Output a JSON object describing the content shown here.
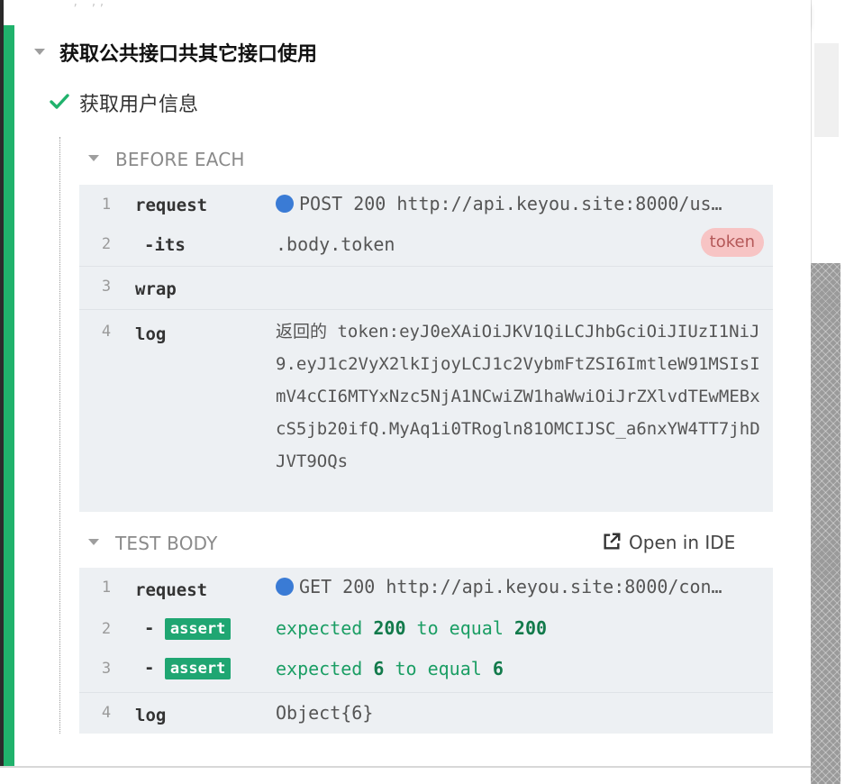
{
  "top_partial_text": "` , ` , ,",
  "suite": {
    "title": "获取公共接口共其它接口使用",
    "caret_icon": "caret-down-icon"
  },
  "test": {
    "title": "获取用户信息",
    "status_icon": "check-icon",
    "status_color": "#20b26c"
  },
  "before_each": {
    "title": "BEFORE EACH",
    "rows": [
      {
        "num": "1",
        "command": "request",
        "method": "POST",
        "status": "200",
        "url": "http://api.keyou.site:8000/us…",
        "message": "POST 200 http://api.keyou.site:8000/us…"
      },
      {
        "num": "2",
        "command": "-its",
        "message": ".body.token",
        "alias": "token"
      },
      {
        "num": "3",
        "command": "wrap",
        "message": ""
      },
      {
        "num": "4",
        "command": "log",
        "message": "返回的 token:eyJ0eXAiOiJKV1QiLCJhbGciOiJIUzI1NiJ9.eyJ1c2VyX2lkIjoyLCJ1c2VybmFtZSI6ImtleW91MSIsImV4cCI6MTYxNzc5NjA1NCwiZW1haWwiOiJrZXlvdTEwMEBxcS5jb20ifQ.MyAq1i0TRogln81OMCIJSC_a6nxYW4TT7jhDJVT9OQs"
      }
    ]
  },
  "test_body": {
    "title": "TEST BODY",
    "open_in_ide": "Open in IDE",
    "rows": [
      {
        "num": "1",
        "command": "request",
        "message": "GET 200 http://api.keyou.site:8000/con…"
      },
      {
        "num": "2",
        "command": "assert",
        "prefix": "-",
        "expected_word": "expected",
        "value1": "200",
        "to_equal": "to equal",
        "value2": "200"
      },
      {
        "num": "3",
        "command": "assert",
        "prefix": "-",
        "expected_word": "expected",
        "value1": "6",
        "to_equal": "to equal",
        "value2": "6"
      },
      {
        "num": "4",
        "command": "log",
        "message": "Object{6}"
      }
    ]
  },
  "colors": {
    "accent_green": "#20b26c",
    "request_dot": "#3a7bd5",
    "alias_bg": "#f7c4c4",
    "command_bg": "#edf0f3"
  }
}
